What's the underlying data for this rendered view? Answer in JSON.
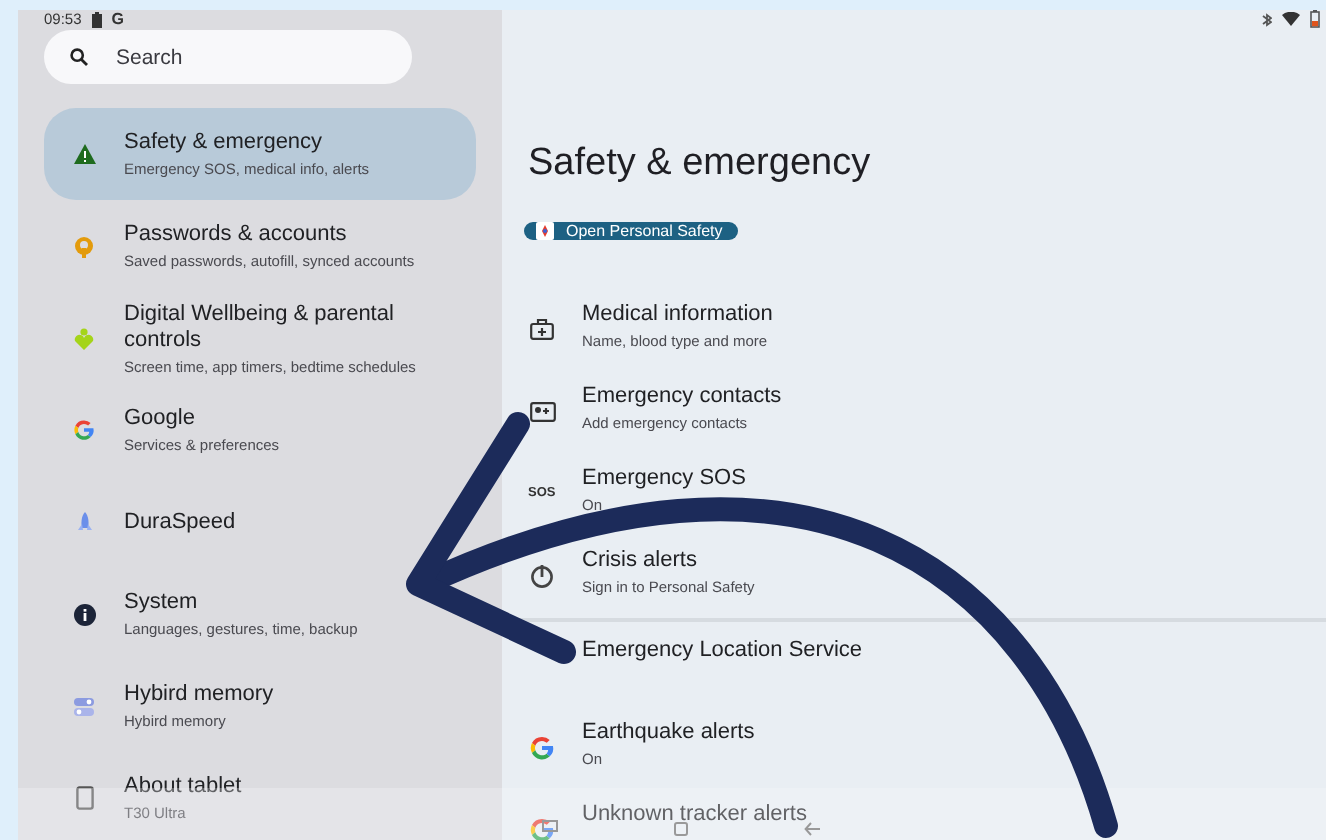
{
  "status_bar": {
    "time": "09:53",
    "notification": "G"
  },
  "search": {
    "placeholder": "Search"
  },
  "sidebar": {
    "items": [
      {
        "kind": "warning",
        "title": "Safety & emergency",
        "subtitle": "Emergency SOS, medical info, alerts",
        "selected": true
      },
      {
        "kind": "key",
        "title": "Passwords & accounts",
        "subtitle": "Saved passwords, autofill, synced accounts",
        "selected": false
      },
      {
        "kind": "wellbeing",
        "title": "Digital Wellbeing & parental controls",
        "subtitle": "Screen time, app timers, bedtime schedules",
        "selected": false
      },
      {
        "kind": "google",
        "title": "Google",
        "subtitle": "Services & preferences",
        "selected": false
      },
      {
        "kind": "rocket",
        "title": "DuraSpeed",
        "selected": false
      },
      {
        "kind": "info",
        "title": "System",
        "subtitle": "Languages, gestures, time, backup",
        "selected": false
      },
      {
        "kind": "memory",
        "title": "Hybird memory",
        "subtitle": "Hybird memory",
        "selected": false
      },
      {
        "kind": "tablet",
        "title": "About tablet",
        "subtitle": "T30 Ultra",
        "selected": false
      }
    ]
  },
  "page": {
    "title": "Safety & emergency",
    "action_button": "Open Personal Safety",
    "groups": [
      [
        {
          "kind": "medical",
          "title": "Medical information",
          "subtitle": "Name, blood type and more"
        },
        {
          "kind": "contacts",
          "title": "Emergency contacts",
          "subtitle": "Add emergency contacts"
        },
        {
          "kind": "sos",
          "icon_text": "SOS",
          "title": "Emergency SOS",
          "subtitle": "On"
        },
        {
          "kind": "power",
          "title": "Crisis alerts",
          "subtitle": "Sign in to Personal Safety"
        }
      ],
      [
        {
          "title": "Emergency Location Service"
        },
        {
          "kind": "google",
          "title": "Earthquake alerts",
          "subtitle": "On"
        },
        {
          "kind": "google",
          "title": "Unknown tracker alerts"
        }
      ]
    ]
  }
}
